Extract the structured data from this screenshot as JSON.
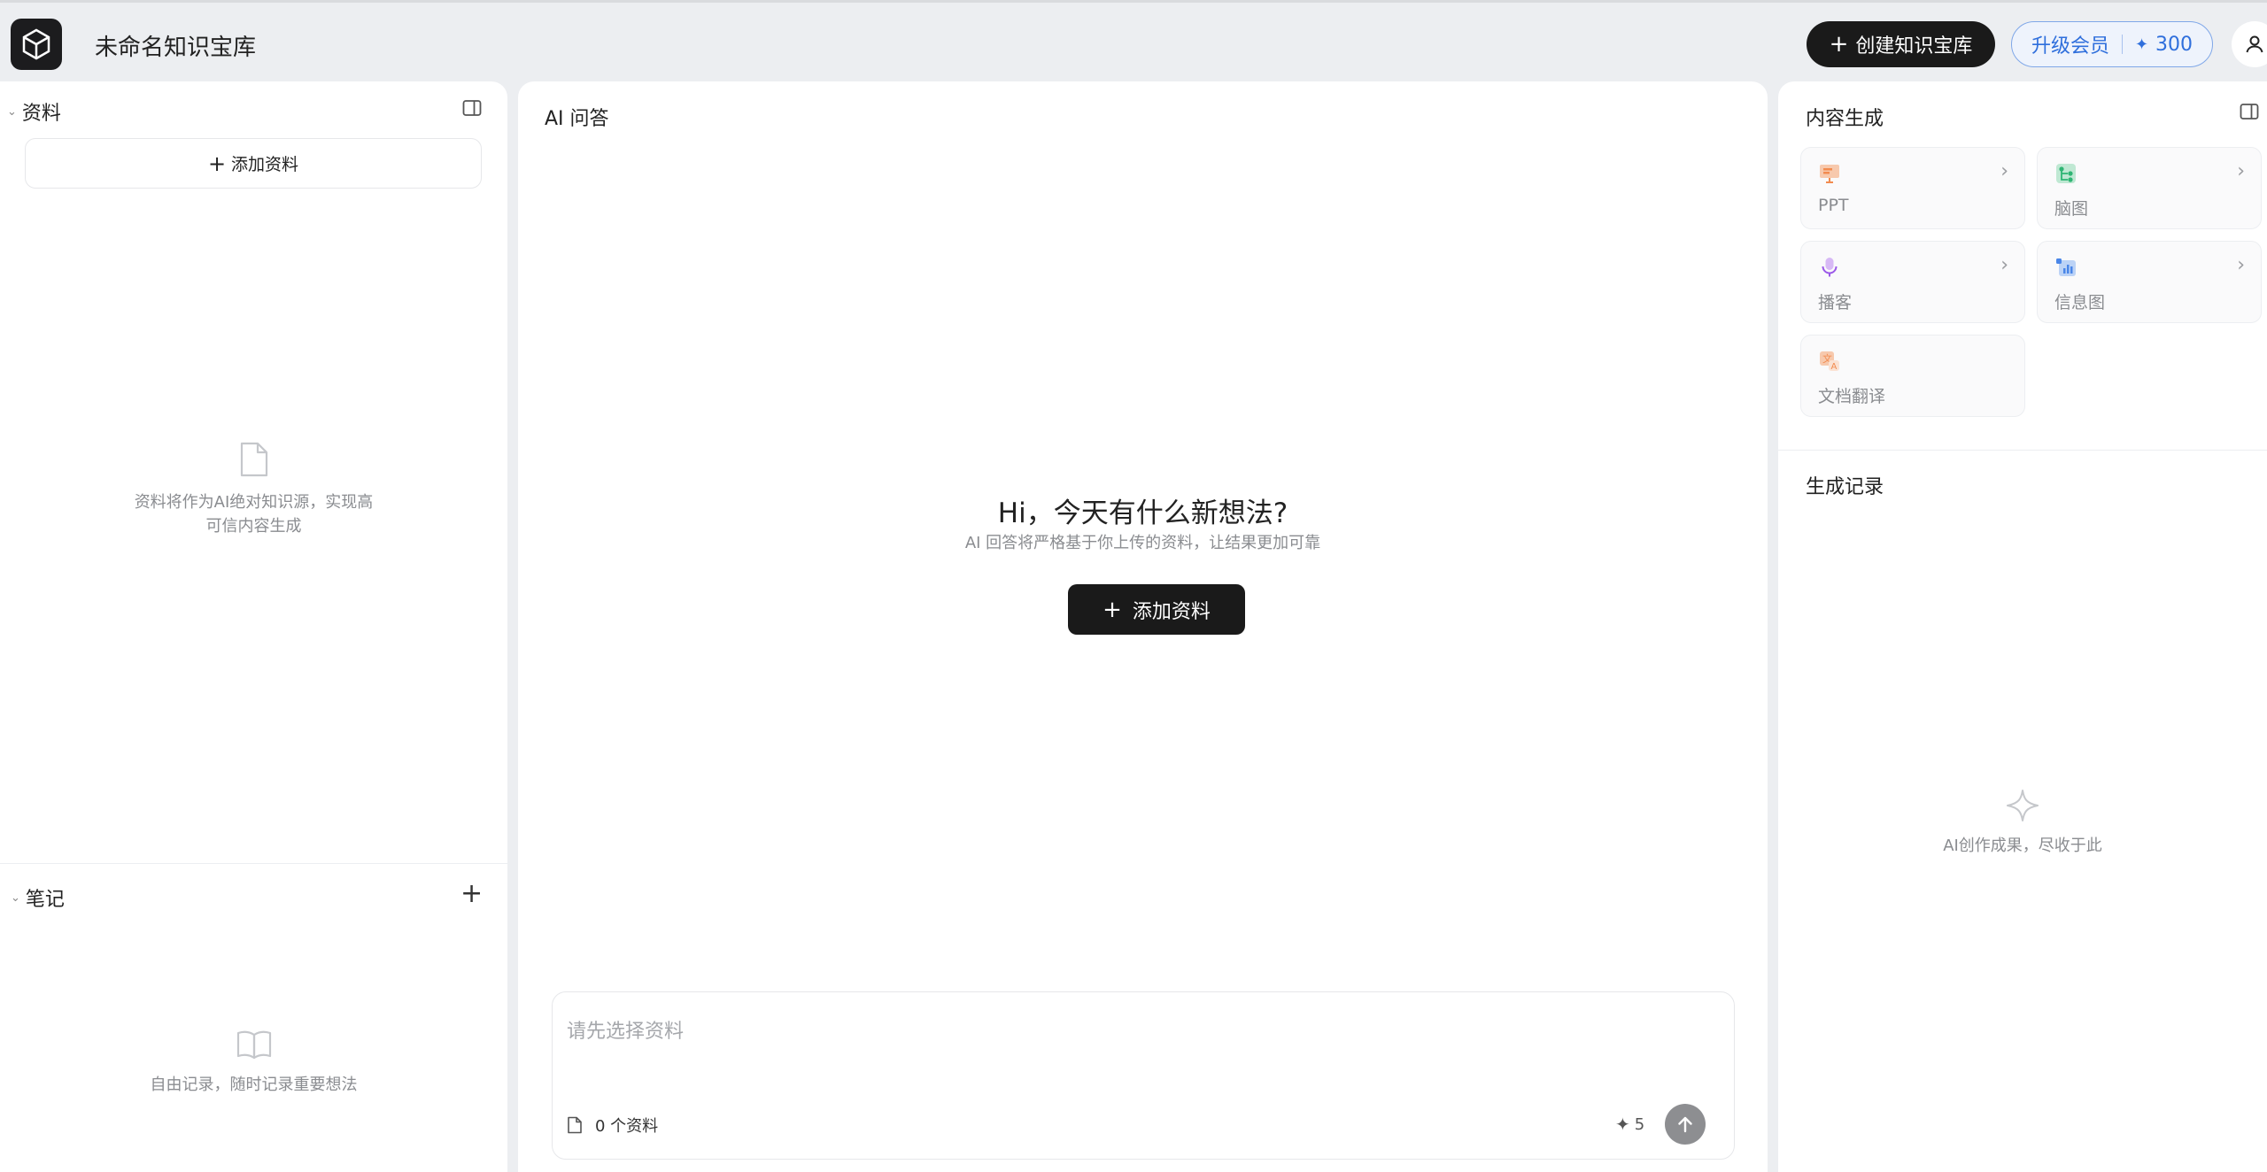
{
  "header": {
    "kb_title": "未命名知识宝库",
    "create_label": "创建知识宝库",
    "upgrade_label": "升级会员",
    "credits": "300"
  },
  "sources": {
    "title": "资料",
    "add_label": "添加资料",
    "empty_text_line1": "资料将作为AI绝对知识源，实现高",
    "empty_text_line2": "可信内容生成"
  },
  "notes": {
    "title": "笔记",
    "empty_text": "自由记录，随时记录重要想法"
  },
  "chat": {
    "title": "AI 问答",
    "hero_title": "Hi，今天有什么新想法?",
    "hero_sub": "AI 回答将严格基于你上传的资料，让结果更加可靠",
    "hero_button": "添加资料",
    "input_placeholder": "请先选择资料",
    "source_count": "0 个资料",
    "cost": "5"
  },
  "generate": {
    "title": "内容生成",
    "tools": [
      {
        "label": "PPT",
        "icon": "ppt-icon",
        "color": "#f28b4f"
      },
      {
        "label": "脑图",
        "icon": "mindmap-icon",
        "color": "#2fb574"
      },
      {
        "label": "播客",
        "icon": "microphone-icon",
        "color": "#9b59e8"
      },
      {
        "label": "信息图",
        "icon": "infographic-icon",
        "color": "#4a86e8"
      },
      {
        "label": "文档翻译",
        "icon": "translate-icon",
        "color": "#f28b4f"
      }
    ],
    "records_title": "生成记录",
    "records_empty": "AI创作成果，尽收于此"
  }
}
